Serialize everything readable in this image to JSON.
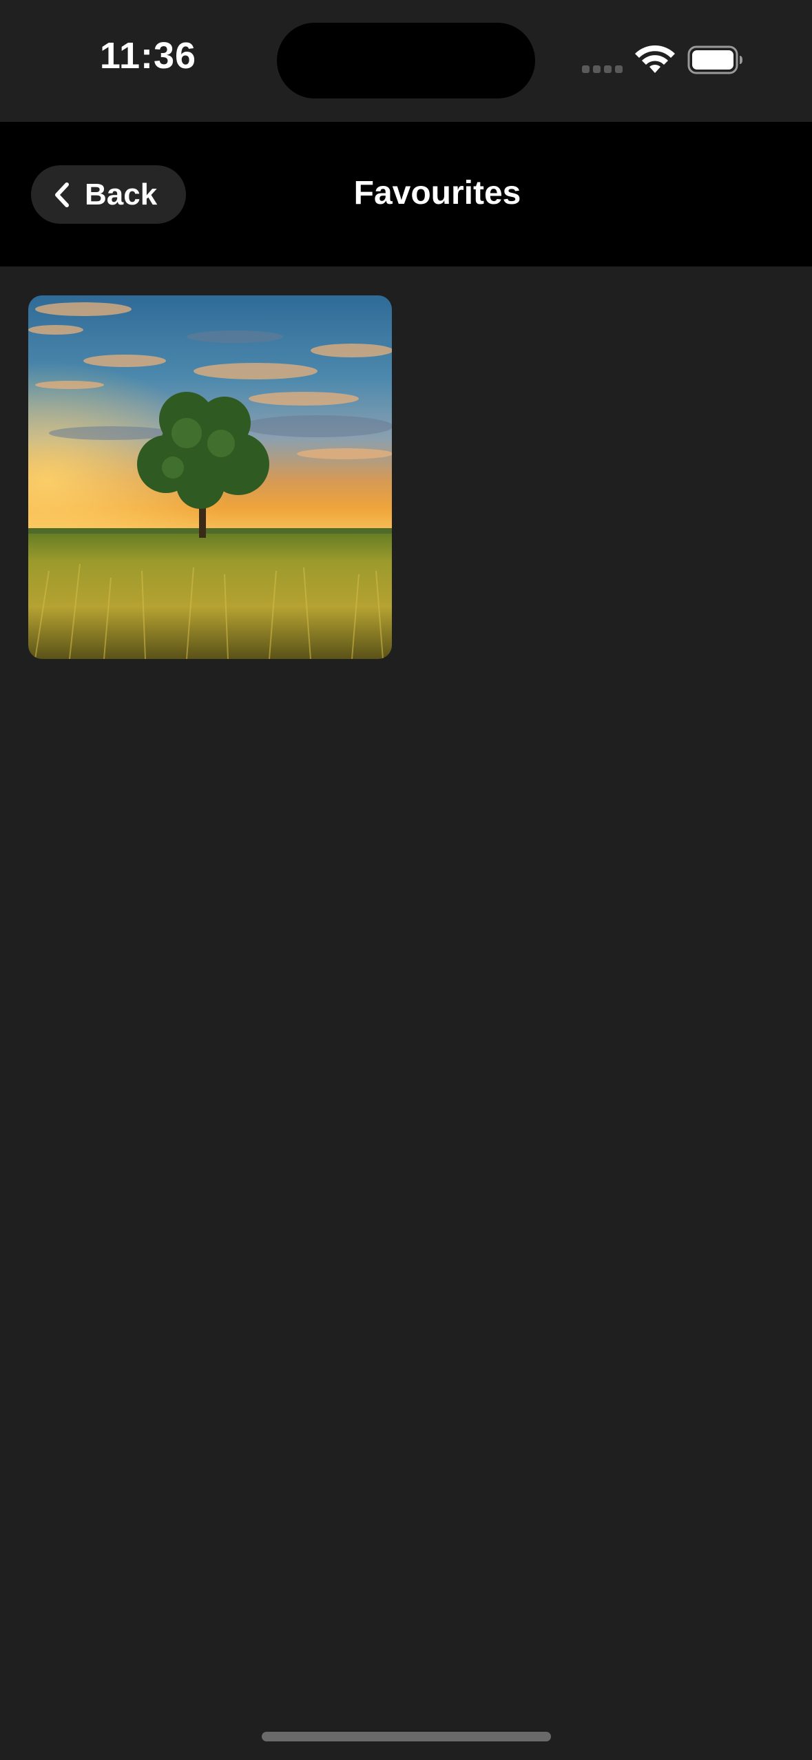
{
  "status_bar": {
    "time": "11:36"
  },
  "nav": {
    "back_label": "Back",
    "title": "Favourites"
  },
  "favourites": [
    {
      "image": "tree-in-wheat-field-at-sunset"
    }
  ],
  "colors": {
    "background": "#1f1f1f",
    "nav_background": "#000000",
    "back_button_background": "#262626",
    "text": "#ffffff"
  }
}
